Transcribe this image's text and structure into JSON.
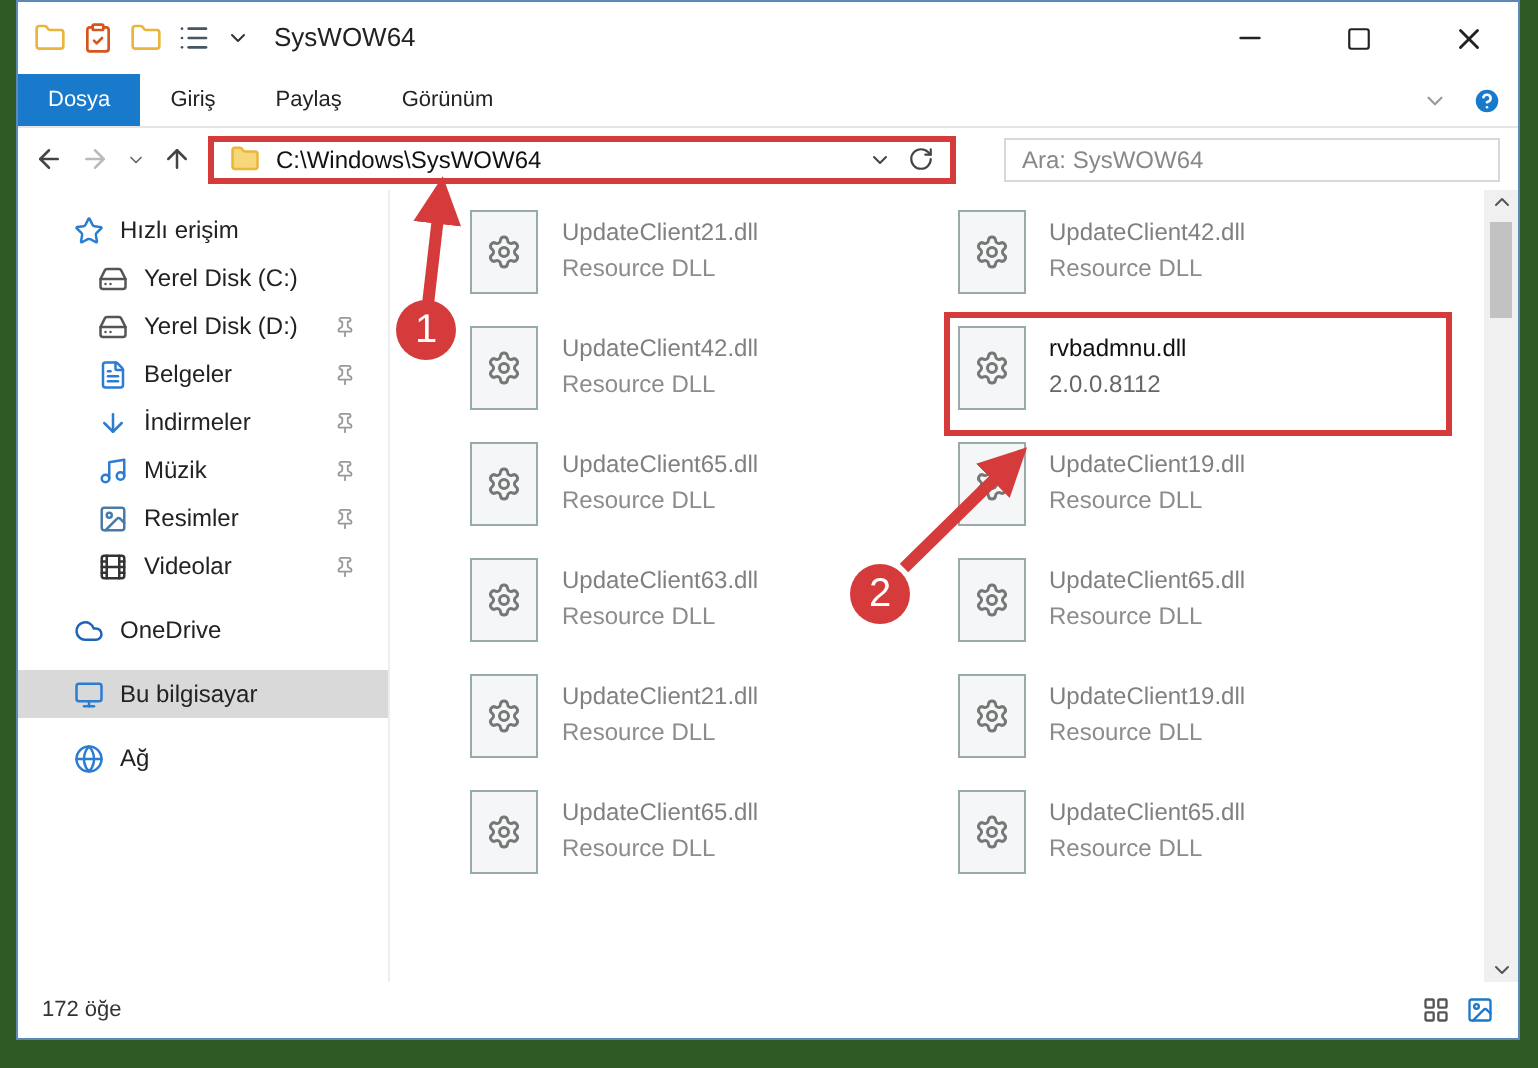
{
  "window": {
    "title": "SysWOW64"
  },
  "ribbon_tabs": [
    {
      "label": "Dosya",
      "selected": true
    },
    {
      "label": "Giriş",
      "selected": false
    },
    {
      "label": "Paylaş",
      "selected": false
    },
    {
      "label": "Görünüm",
      "selected": false
    }
  ],
  "address_bar": {
    "path": "C:\\Windows\\SysWOW64",
    "highlighted": true
  },
  "search": {
    "placeholder": "Ara: SysWOW64"
  },
  "sidebar": {
    "items": [
      {
        "label": "Hızlı erişim",
        "kind": "star",
        "selected": false,
        "children": [
          {
            "label": "Yerel Disk (C:)",
            "kind": "drive-c",
            "pinned": false,
            "selected": false
          },
          {
            "label": "Yerel Disk (D:)",
            "kind": "drive",
            "pinned": true,
            "selected": false
          },
          {
            "label": "Belgeler",
            "kind": "document",
            "pinned": true,
            "selected": false
          },
          {
            "label": "İndirmeler",
            "kind": "download",
            "pinned": true,
            "selected": false
          },
          {
            "label": "Müzik",
            "kind": "music",
            "pinned": true,
            "selected": false
          },
          {
            "label": "Resimler",
            "kind": "picture",
            "pinned": true,
            "selected": false
          },
          {
            "label": "Videolar",
            "kind": "video",
            "pinned": true,
            "selected": false
          }
        ]
      },
      {
        "label": "OneDrive",
        "kind": "cloud",
        "selected": false
      },
      {
        "label": "Bu bilgisayar",
        "kind": "computer",
        "selected": true
      },
      {
        "label": "Ağ",
        "kind": "network",
        "selected": false
      }
    ]
  },
  "files": [
    {
      "name": "UpdateClient21.dll",
      "detail": "Resource DLL",
      "dimmed": true,
      "highlighted": false
    },
    {
      "name": "UpdateClient42.dll",
      "detail": "Resource DLL",
      "dimmed": true,
      "highlighted": false
    },
    {
      "name": "UpdateClient42.dll",
      "detail": "Resource DLL",
      "dimmed": true,
      "highlighted": false
    },
    {
      "name": "rvbadmnu.dll",
      "detail": "2.0.0.8112",
      "dimmed": false,
      "highlighted": true
    },
    {
      "name": "UpdateClient65.dll",
      "detail": "Resource DLL",
      "dimmed": true,
      "highlighted": false
    },
    {
      "name": "UpdateClient19.dll",
      "detail": "Resource DLL",
      "dimmed": true,
      "highlighted": false
    },
    {
      "name": "UpdateClient63.dll",
      "detail": "Resource DLL",
      "dimmed": true,
      "highlighted": false
    },
    {
      "name": "UpdateClient65.dll",
      "detail": "Resource DLL",
      "dimmed": true,
      "highlighted": false
    },
    {
      "name": "UpdateClient21.dll",
      "detail": "Resource DLL",
      "dimmed": true,
      "highlighted": false
    },
    {
      "name": "UpdateClient19.dll",
      "detail": "Resource DLL",
      "dimmed": true,
      "highlighted": false
    },
    {
      "name": "UpdateClient65.dll",
      "detail": "Resource DLL",
      "dimmed": true,
      "highlighted": false
    },
    {
      "name": "UpdateClient65.dll",
      "detail": "Resource DLL",
      "dimmed": true,
      "highlighted": false
    }
  ],
  "status_bar": {
    "count": "172 öğe"
  },
  "annotations": [
    {
      "number": "1"
    },
    {
      "number": "2"
    }
  ]
}
